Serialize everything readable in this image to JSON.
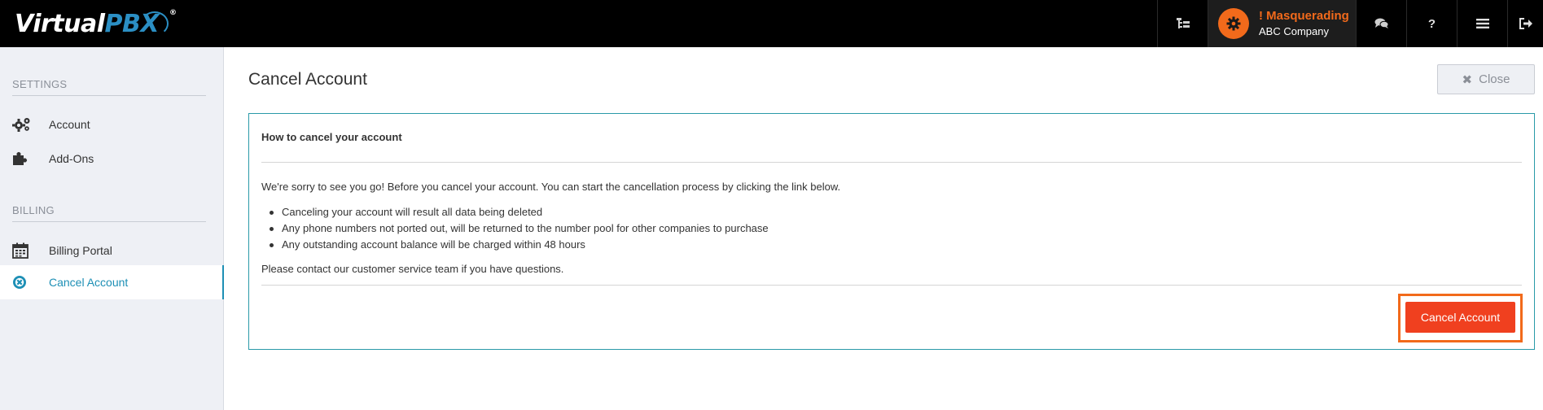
{
  "brand": {
    "name_part1": "Virtual",
    "name_part2": "PBX",
    "registered": "®"
  },
  "topnav": {
    "masquerade_title": "! Masquerading",
    "masquerade_company": "ABC Company",
    "icons": [
      "org-chart-icon",
      "gear-icon",
      "chat-icon",
      "help-icon",
      "menu-icon",
      "logout-icon"
    ],
    "help_glyph": "?"
  },
  "sidebar": {
    "sections": [
      {
        "title": "SETTINGS",
        "items": [
          {
            "label": "Account",
            "icon": "gears-icon"
          },
          {
            "label": "Add-Ons",
            "icon": "puzzle-icon"
          }
        ]
      },
      {
        "title": "BILLING",
        "items": [
          {
            "label": "Billing Portal",
            "icon": "calendar-icon"
          },
          {
            "label": "Cancel Account",
            "icon": "cancel-circle-icon",
            "active": true
          }
        ]
      }
    ]
  },
  "main": {
    "page_title": "Cancel Account",
    "close_label": "Close",
    "panel": {
      "heading": "How to cancel your account",
      "intro": "We're sorry to see you go! Before you cancel your account. You can start the cancellation process by clicking the link below.",
      "bullets": [
        "Canceling your account will result all data being deleted",
        "Any phone numbers not ported out, will be returned to the number pool for other companies to purchase",
        "Any outstanding account balance will be charged within 48 hours"
      ],
      "contact": "Please contact our customer service team if you have questions.",
      "cancel_button": "Cancel Account"
    }
  },
  "colors": {
    "accent": "#1d8fb5",
    "masquerade": "#f26a1b",
    "cancel_button": "#f0401f",
    "panel_border": "#2a9aa8"
  }
}
